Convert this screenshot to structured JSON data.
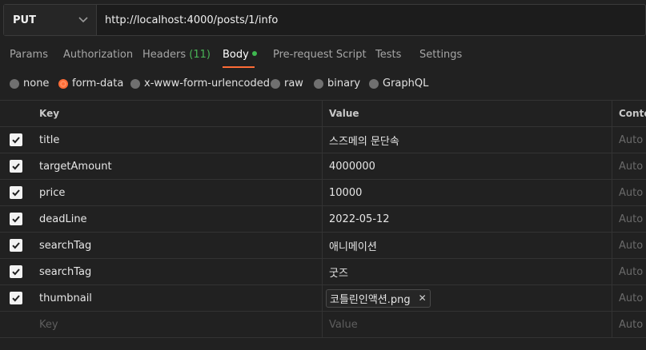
{
  "request": {
    "method": "PUT",
    "url": "http://localhost:4000/posts/1/info"
  },
  "tabs": [
    {
      "label": "Params"
    },
    {
      "label": "Authorization"
    },
    {
      "label": "Headers",
      "count": "(11)"
    },
    {
      "label": "Body"
    },
    {
      "label": "Pre-request Script"
    },
    {
      "label": "Tests"
    },
    {
      "label": "Settings"
    }
  ],
  "body_types": [
    "none",
    "form-data",
    "x-www-form-urlencoded",
    "raw",
    "binary",
    "GraphQL"
  ],
  "selected_body_type": "form-data",
  "table": {
    "headers": {
      "key": "Key",
      "value": "Value",
      "content_type": "Conte"
    },
    "rows": [
      {
        "key": "title",
        "value": "스즈메의 문단속",
        "content_type": "Auto",
        "checked": true
      },
      {
        "key": "targetAmount",
        "value": "4000000",
        "content_type": "Auto",
        "checked": true
      },
      {
        "key": "price",
        "value": "10000",
        "content_type": "Auto",
        "checked": true
      },
      {
        "key": "deadLine",
        "value": "2022-05-12",
        "content_type": "Auto",
        "checked": true
      },
      {
        "key": "searchTag",
        "value": "애니메이션",
        "content_type": "Auto",
        "checked": true
      },
      {
        "key": "searchTag",
        "value": "굿즈",
        "content_type": "Auto",
        "checked": true
      },
      {
        "key": "thumbnail",
        "value": "코틀린인액션.png",
        "content_type": "Auto",
        "checked": true
      }
    ],
    "empty_row": {
      "key_placeholder": "Key",
      "value_placeholder": "Value",
      "content_type": "Auto"
    }
  },
  "colors": {
    "accent": "#ff6c37",
    "body_dot": "#3fb950",
    "header_count": "#49b356"
  },
  "icons": {
    "method_dropdown": "chevron-down-icon",
    "checkbox": "check-icon",
    "remove_file": "close-icon"
  }
}
